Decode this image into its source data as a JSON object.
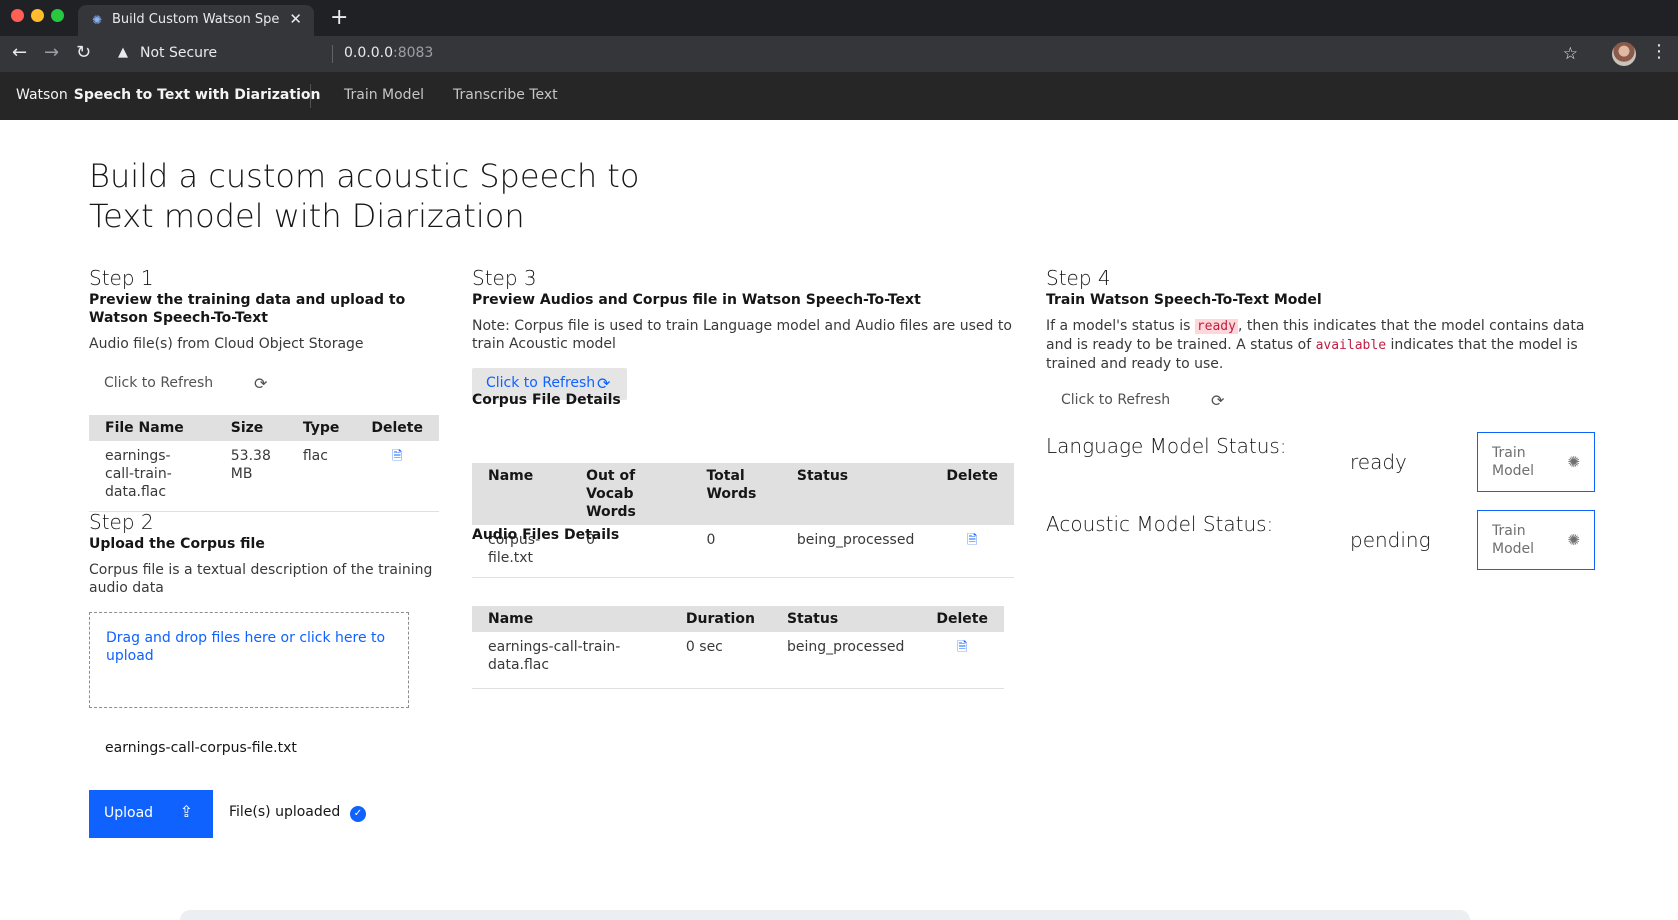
{
  "browser": {
    "tab_title": "Build Custom Watson Speech to Text",
    "security": "Not Secure",
    "url_host": "0.0.0.0",
    "url_port": ":8083",
    "colors": {
      "close": "#ff5f57",
      "minimize": "#febc2e",
      "maximize": "#28c840"
    }
  },
  "header": {
    "brand_prefix": "Watson",
    "brand_name": "Speech to Text with Diarization",
    "nav": [
      "Train Model",
      "Transcribe Text"
    ]
  },
  "page_title": "Build a custom acoustic Speech to Text model with Diarization",
  "step1": {
    "heading": "Step 1",
    "subheading": "Preview the training data and upload to Watson Speech-To-Text",
    "description": "Audio file(s) from Cloud Object Storage",
    "refresh_label": "Click to Refresh",
    "columns": [
      "File Name",
      "Size",
      "Type",
      "Delete"
    ],
    "rows": [
      {
        "name": "earnings-call-train-data.flac",
        "size": "53.38 MB",
        "type": "flac"
      }
    ]
  },
  "step2": {
    "heading": "Step 2",
    "subheading": "Upload the Corpus file",
    "description": "Corpus file is a textual description of the training audio data",
    "dropzone_label": "Drag and drop files here or click here to upload",
    "selected_file": "earnings-call-corpus-file.txt",
    "upload_label": "Upload",
    "upload_status": "File(s) uploaded"
  },
  "step3": {
    "heading": "Step 3",
    "subheading": "Preview Audios and Corpus file in Watson Speech-To-Text",
    "note": "Note: Corpus file is used to train Language model and Audio files are used to train Acoustic model",
    "refresh_label": "Click to Refresh",
    "corpus_title": "Corpus File Details",
    "corpus_columns": [
      "Name",
      "Out of Vocab Words",
      "Total Words",
      "Status",
      "Delete"
    ],
    "corpus_rows": [
      {
        "name": "corpus-file.txt",
        "oov": "0",
        "total": "0",
        "status": "being_processed"
      }
    ],
    "audio_title": "Audio Files Details",
    "audio_columns": [
      "Name",
      "Duration",
      "Status",
      "Delete"
    ],
    "audio_rows": [
      {
        "name": "earnings-call-train-data.flac",
        "duration": "0 sec",
        "status": "being_processed"
      }
    ]
  },
  "step4": {
    "heading": "Step 4",
    "subheading": "Train Watson Speech-To-Text Model",
    "desc_part1": "If a model's status is ",
    "desc_code1": "ready",
    "desc_part2": ", then this indicates that the model contains data and is ready to be trained. A status of ",
    "desc_code2": "available",
    "desc_part3": " indicates that the model is trained and ready to use.",
    "refresh_label": "Click to Refresh",
    "language_label": "Language Model Status:",
    "language_status": "ready",
    "acoustic_label": "Acoustic Model Status:",
    "acoustic_status": "pending",
    "train_label": "Train Model"
  },
  "icons": {
    "refresh": "refresh-icon",
    "delete": "document-icon",
    "upload": "upload-icon",
    "check": "checkmark-icon",
    "train": "watson-icon"
  }
}
